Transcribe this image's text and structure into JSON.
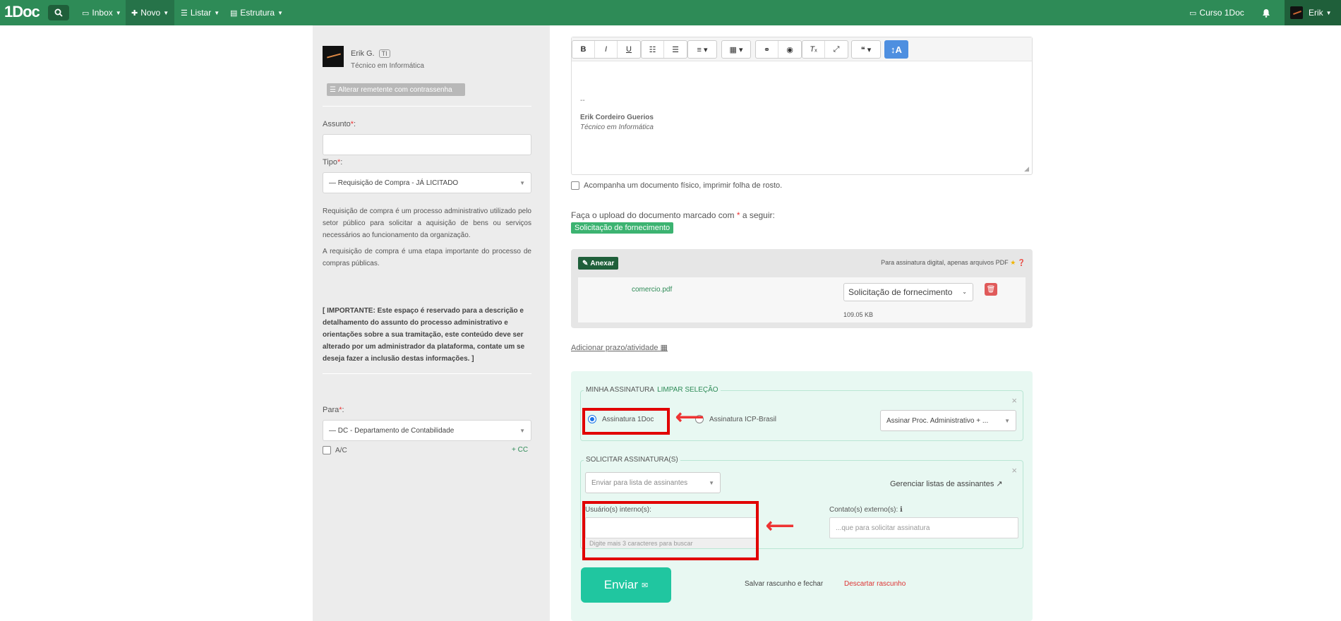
{
  "navbar": {
    "brand": "1Doc",
    "inbox": "Inbox",
    "novo": "Novo",
    "listar": "Listar",
    "estrutura": "Estrutura",
    "curso": "Curso 1Doc",
    "user": "Erik"
  },
  "sender": {
    "name": "Erik G.",
    "badge": "TI",
    "role": "Técnico em Informática",
    "change_button": "Alterar remetente com contrassenha"
  },
  "form": {
    "assunto_label": "Assunto",
    "assunto_value": "",
    "tipo_label": "Tipo",
    "tipo_value": "— Requisição de Compra - JÁ LICITADO",
    "description_1": "Requisição de compra é um processo administrativo utilizado pelo setor público para solicitar a aquisição de bens ou serviços necessários ao funcionamento da organização.",
    "description_2": "A requisição de compra é uma etapa importante do processo de compras públicas.",
    "important_note": "[ IMPORTANTE: Este espaço é reservado para a descrição e detalhamento do assunto do processo administrativo e orientações sobre a sua tramitação, este conteúdo deve ser alterado por um administrador da plataforma, contate um se deseja fazer a inclusão destas informações. ]",
    "para_label": "Para",
    "para_value": "— DC - Departamento de Contabilidade",
    "ac_label": "A/C",
    "cc_link": "+ CC",
    "required_mark": "*",
    "colon": ":"
  },
  "editor": {
    "signature_dash": "--",
    "signature_name": "Erik Cordeiro Guerios",
    "signature_role": "Técnico em Informática"
  },
  "physical_doc_label": "Acompanha um documento físico, imprimir folha de rosto.",
  "upload": {
    "instruction_before": "Faça o upload do documento marcado com",
    "instruction_mark": "*",
    "instruction_after": "a seguir:",
    "required_doc_tag": "Solicitação de fornecimento",
    "attach_button": "Anexar",
    "pdf_note": "Para assinatura digital, apenas arquivos PDF",
    "file_name": "comercio.pdf",
    "file_type": "Solicitação de fornecimento",
    "file_size": "109.05 KB"
  },
  "deadline_link": "Adicionar prazo/atividade",
  "signature": {
    "minha_legend": "MINHA ASSINATURA",
    "limpar": "LIMPAR SELEÇÃO",
    "option_1doc": "Assinatura 1Doc",
    "option_icp": "Assinatura ICP-Brasil",
    "sign_select": "Assinar Proc. Administrativo + ...",
    "solicitar_legend": "SOLICITAR ASSINATURA(S)",
    "list_select": "Enviar para lista de assinantes",
    "manage_lists": "Gerenciar listas de assinantes",
    "internal_label": "Usuário(s) interno(s):",
    "internal_hint": "Digite mais 3 caracteres para buscar",
    "external_label": "Contato(s) externo(s):",
    "external_placeholder": "...que para solicitar assinatura"
  },
  "actions": {
    "send": "Enviar",
    "save_draft": "Salvar rascunho e fechar",
    "discard_draft": "Descartar rascunho"
  },
  "colors": {
    "navbar": "#2e8b57",
    "send_button": "#20c6a0",
    "highlight": "#e10000"
  }
}
